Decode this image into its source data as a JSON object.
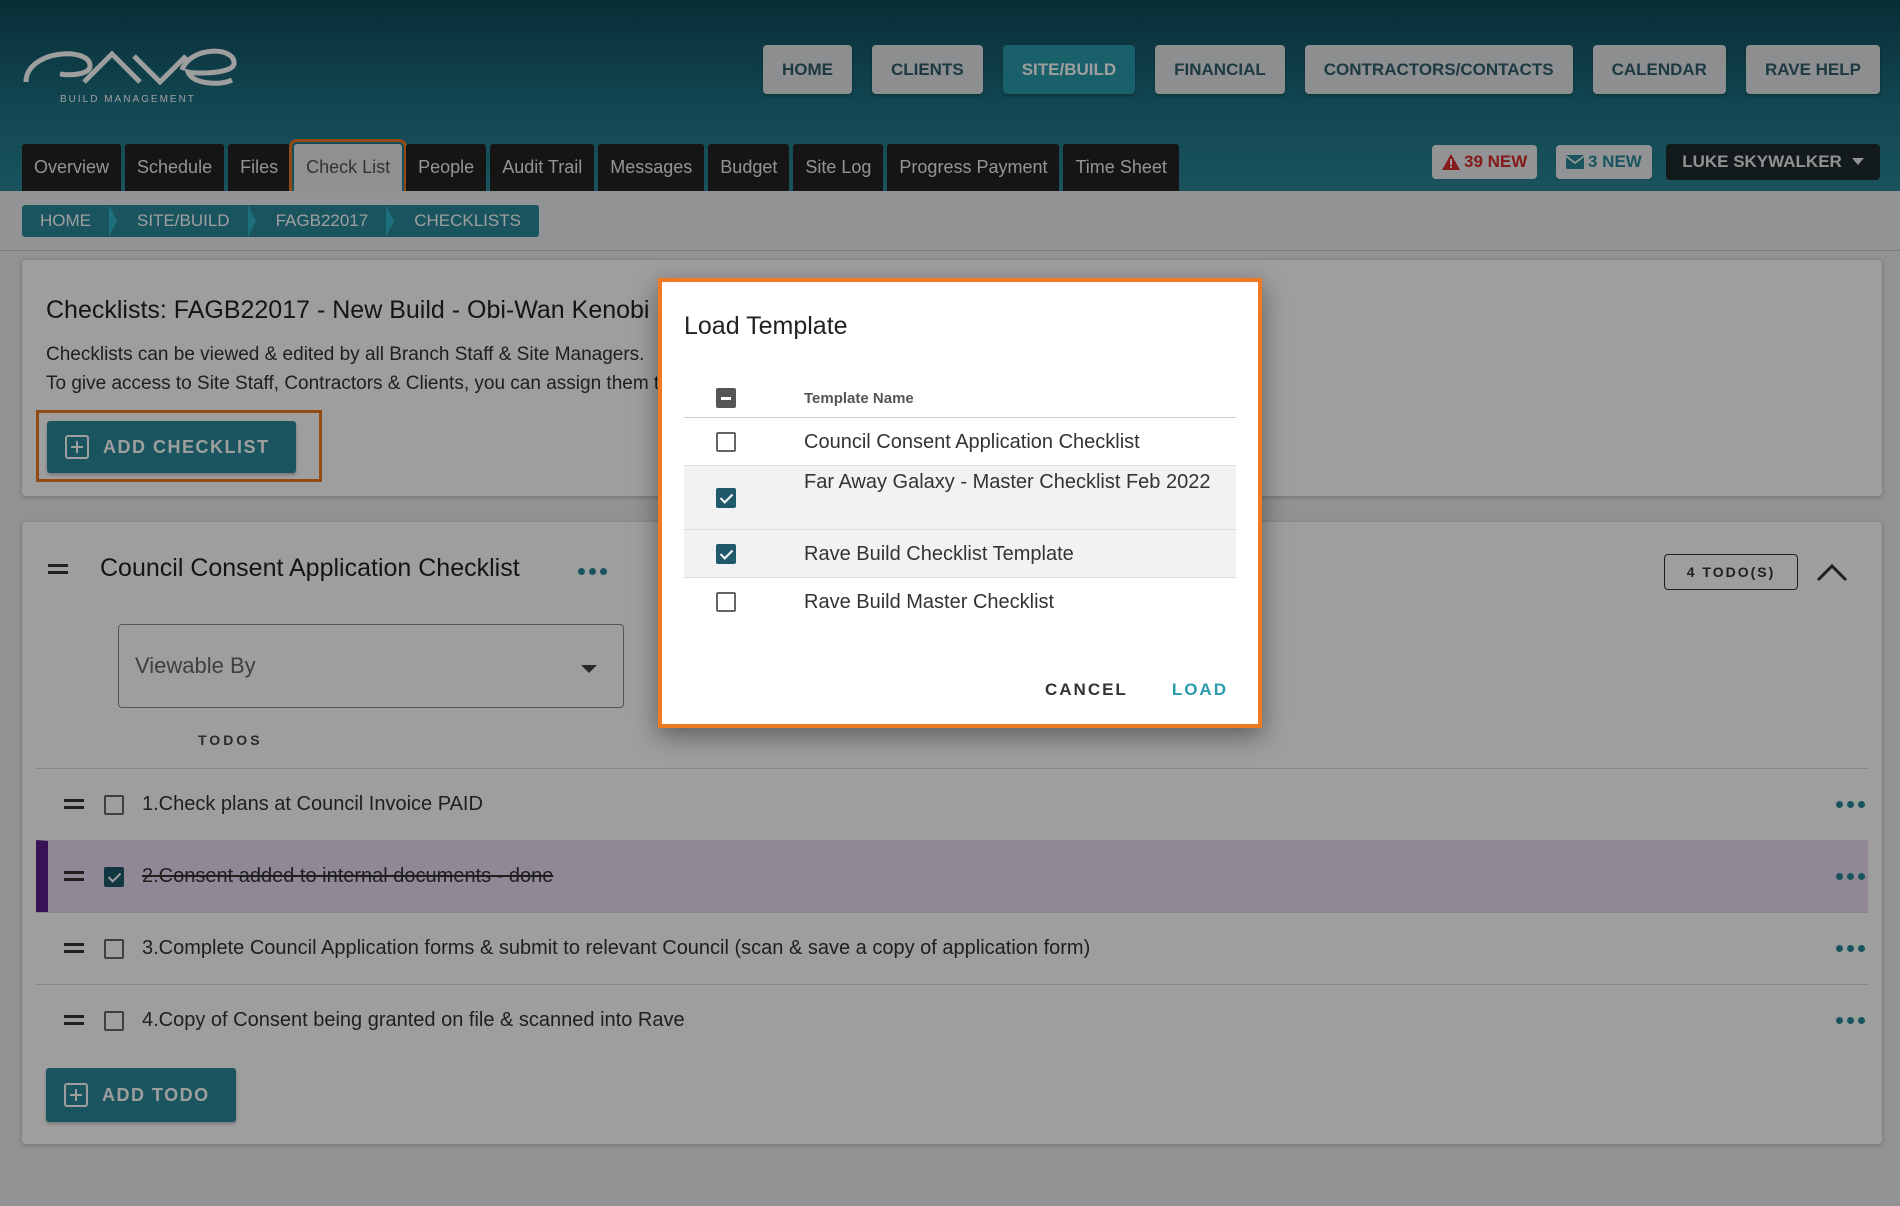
{
  "header": {
    "logo_subtitle": "BUILD MANAGEMENT",
    "nav": [
      {
        "label": "HOME",
        "active": false
      },
      {
        "label": "CLIENTS",
        "active": false
      },
      {
        "label": "SITE/BUILD",
        "active": true
      },
      {
        "label": "FINANCIAL",
        "active": false
      },
      {
        "label": "CONTRACTORS/CONTACTS",
        "active": false
      },
      {
        "label": "CALENDAR",
        "active": false
      },
      {
        "label": "RAVE HELP",
        "active": false
      }
    ],
    "tabs": [
      {
        "label": "Overview",
        "active": false
      },
      {
        "label": "Schedule",
        "active": false
      },
      {
        "label": "Files",
        "active": false
      },
      {
        "label": "Check List",
        "active": true
      },
      {
        "label": "People",
        "active": false
      },
      {
        "label": "Audit Trail",
        "active": false
      },
      {
        "label": "Messages",
        "active": false
      },
      {
        "label": "Budget",
        "active": false
      },
      {
        "label": "Site Log",
        "active": false
      },
      {
        "label": "Progress Payment",
        "active": false
      },
      {
        "label": "Time Sheet",
        "active": false
      }
    ],
    "alerts_label": "39 NEW",
    "messages_label": "3 NEW",
    "user_name": "LUKE SKYWALKER"
  },
  "breadcrumb": [
    "HOME",
    "SITE/BUILD",
    "FAGB22017",
    "CHECKLISTS"
  ],
  "checklists_card": {
    "title": "Checklists: FAGB22017 - New Build - Obi-Wan Kenobi",
    "desc_line1": "Checklists can be viewed & edited by all Branch Staff & Site Managers.",
    "desc_line2": "To give access to Site Staff, Contractors & Clients, you can assign them to each checklist.",
    "add_checklist_label": "ADD CHECKLIST"
  },
  "checklist": {
    "title": "Council Consent Application Checklist",
    "todo_count": "4 TODO(S)",
    "viewable_placeholder": "Viewable By",
    "todos_label": "TODOS",
    "todos": [
      {
        "text": "1.Check plans at Council Invoice PAID",
        "done": false
      },
      {
        "text": "2.Consent added to internal documents - done",
        "done": true
      },
      {
        "text": "3.Complete Council Application forms & submit to relevant Council (scan & save a copy of application form)",
        "done": false
      },
      {
        "text": "4.Copy of Consent being granted on file & scanned into Rave",
        "done": false
      }
    ],
    "add_todo_label": "ADD TODO"
  },
  "modal": {
    "title": "Load Template",
    "column_header": "Template Name",
    "templates": [
      {
        "name": "Council Consent Application Checklist",
        "checked": false
      },
      {
        "name": "Far Away Galaxy - Master Checklist Feb 2022",
        "checked": true
      },
      {
        "name": "Rave Build Checklist Template",
        "checked": true
      },
      {
        "name": "Rave Build Master Checklist",
        "checked": false
      }
    ],
    "cancel_label": "CANCEL",
    "load_label": "LOAD"
  },
  "colors": {
    "accent": "#2a8a9a",
    "highlight": "#ee7a22",
    "done_bar": "#5a1e8a",
    "alert": "#d62a2a"
  }
}
